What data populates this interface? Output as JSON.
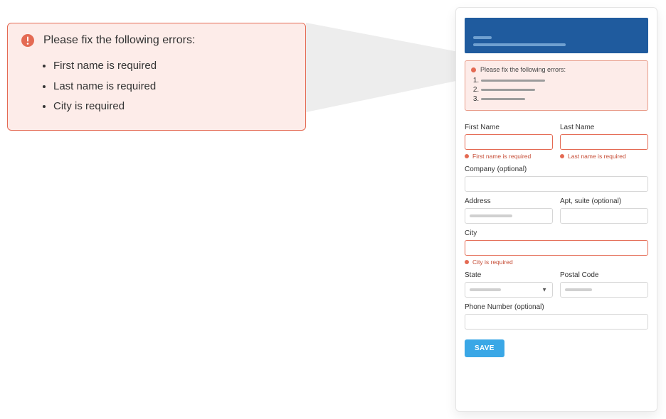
{
  "callout": {
    "title": "Please fix the following errors:",
    "errors": [
      "First name is required",
      "Last name is required",
      "City is required"
    ]
  },
  "mini_banner": {
    "title": "Please fix the following errors:"
  },
  "form": {
    "first_name": {
      "label": "First Name",
      "error": "First name is required"
    },
    "last_name": {
      "label": "Last Name",
      "error": "Last name is required"
    },
    "company": {
      "label": "Company (optional)"
    },
    "address": {
      "label": "Address"
    },
    "apt": {
      "label": "Apt, suite (optional)"
    },
    "city": {
      "label": "City",
      "error": "City is required"
    },
    "state": {
      "label": "State"
    },
    "postal": {
      "label": "Postal Code"
    },
    "phone": {
      "label": "Phone Number (optional)"
    },
    "save_label": "SAVE"
  },
  "colors": {
    "error_bg": "#FDECE9",
    "error_border": "#E46A53",
    "primary": "#3aa7e6",
    "hero": "#1f5b9e"
  }
}
